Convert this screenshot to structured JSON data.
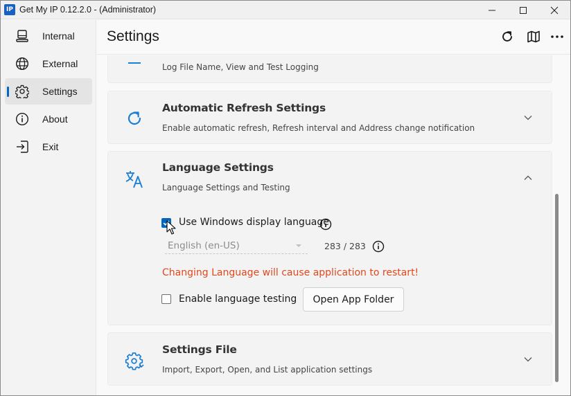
{
  "window": {
    "app_icon_text": "IP",
    "title": "Get My IP  0.12.2.0 - (Administrator)",
    "controls": [
      "minimize-icon",
      "maximize-icon",
      "close-icon"
    ]
  },
  "sidebar": {
    "items": [
      {
        "label": "Internal",
        "icon": "computer-icon"
      },
      {
        "label": "External",
        "icon": "globe-icon"
      },
      {
        "label": "Settings",
        "icon": "gear-icon",
        "selected": true
      },
      {
        "label": "About",
        "icon": "info-icon"
      },
      {
        "label": "Exit",
        "icon": "exit-icon"
      }
    ]
  },
  "header": {
    "title": "Settings",
    "actions": [
      "refresh-icon",
      "map-icon",
      "more-icon"
    ]
  },
  "cards": {
    "logging": {
      "desc": "Log File Name, View and Test Logging",
      "icon": "logging-icon"
    },
    "refresh": {
      "title": "Automatic Refresh Settings",
      "desc": "Enable automatic refresh, Refresh interval and Address change notification",
      "icon": "refresh-icon",
      "expanded": false
    },
    "language": {
      "title": "Language Settings",
      "desc": "Language Settings and Testing",
      "icon": "translate-icon",
      "expanded": true,
      "use_windows_language_label": "Use Windows display language",
      "use_windows_language_checked": true,
      "language_value": "English   (en-US)",
      "translation_count": "283 / 283",
      "warning": "Changing Language will cause application to restart!",
      "enable_testing_label": "Enable language testing",
      "enable_testing_checked": false,
      "open_folder_label": "Open App Folder"
    },
    "settings_file": {
      "title": "Settings File",
      "desc": "Import, Export, Open, and List application settings",
      "icon": "settings-file-icon",
      "expanded": false
    }
  },
  "colors": {
    "accent": "#0067c0",
    "warning": "#e0481e",
    "icon_blue": "#1b7fd4"
  }
}
